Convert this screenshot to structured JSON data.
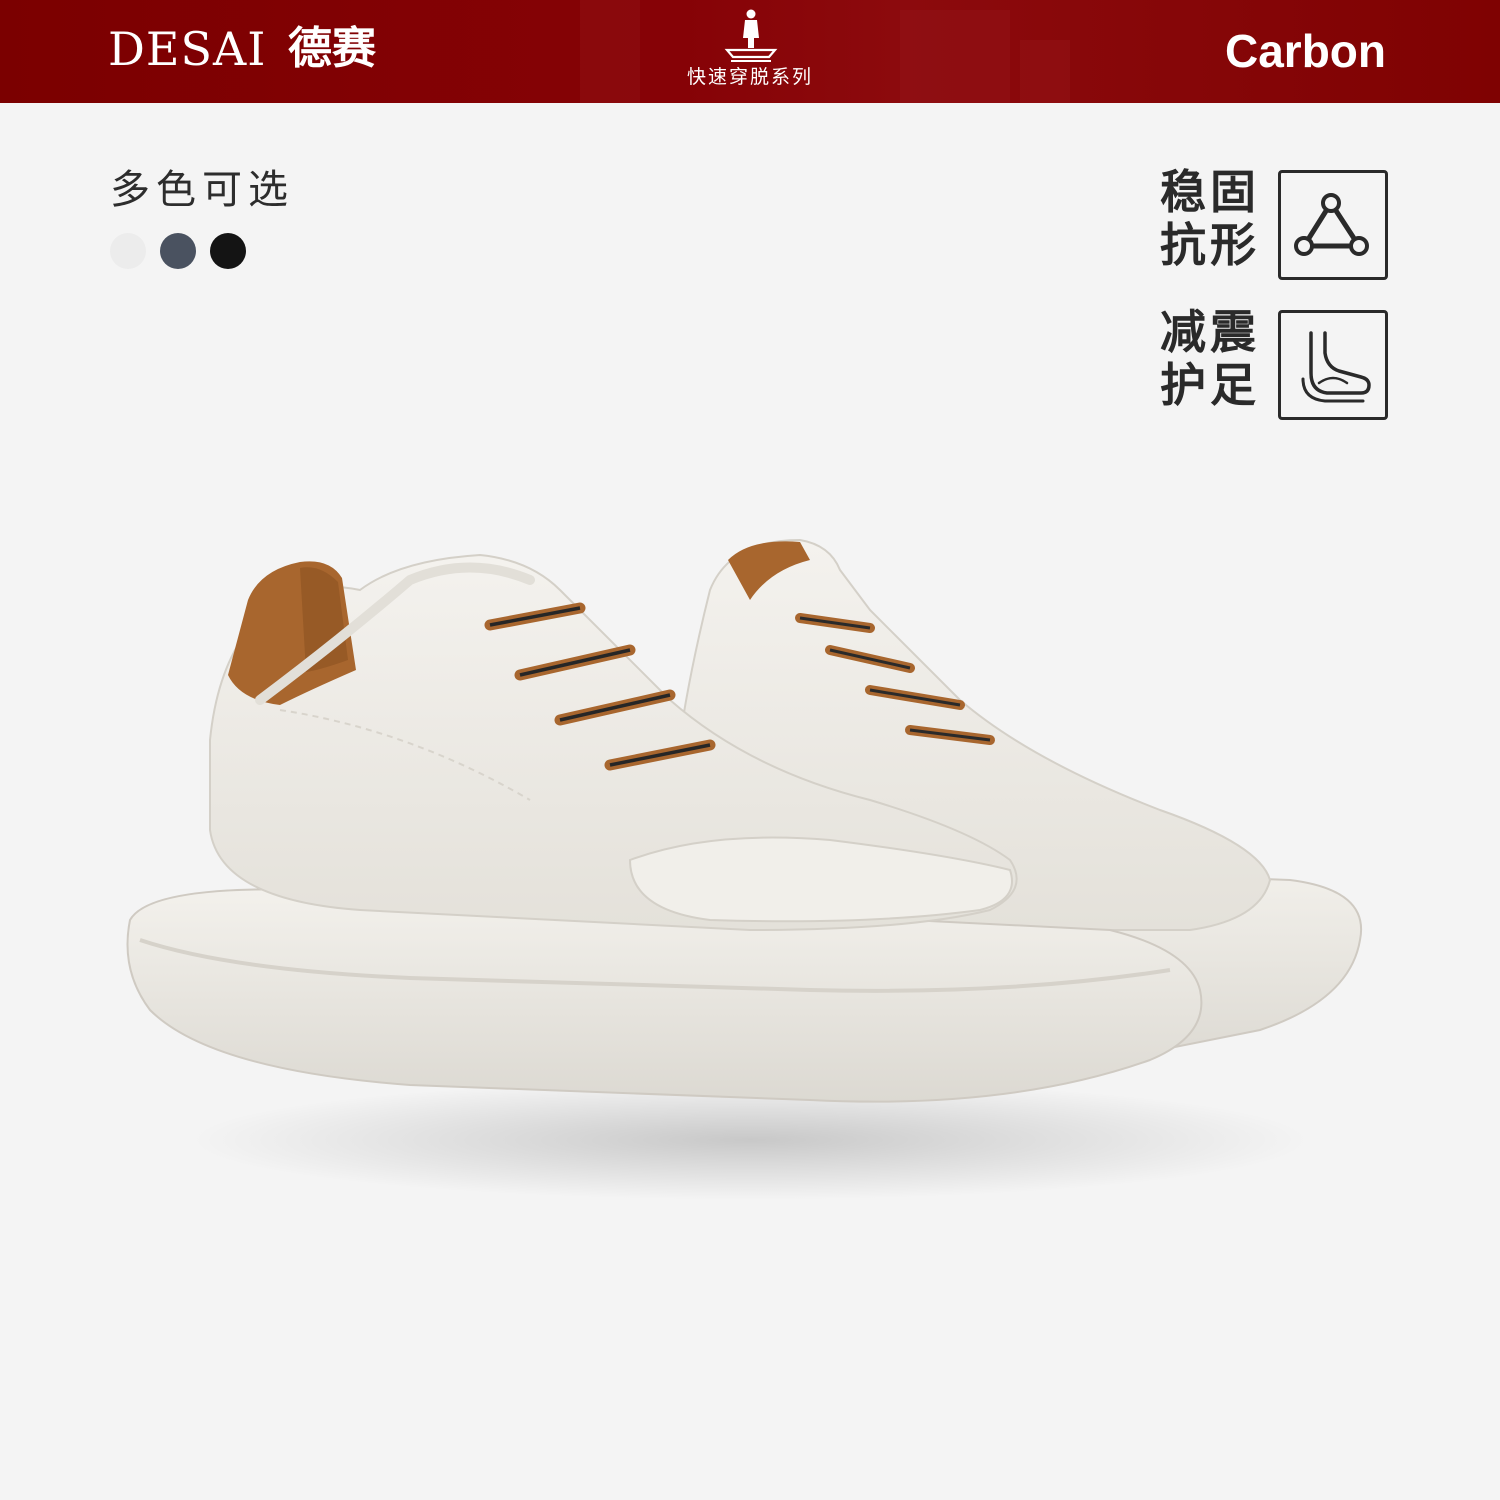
{
  "header": {
    "brand_latin": "DESAI",
    "brand_cn": "德赛",
    "series_title": "快速穿脱系列",
    "model_name": "Carbon",
    "background_color": "#7f0003"
  },
  "colors": {
    "heading": "多色可选",
    "swatches": [
      "#ececec",
      "#4a5260",
      "#141414"
    ]
  },
  "features": [
    {
      "line1": "稳固",
      "line2": "抗形",
      "icon": "triangle-nodes-icon"
    },
    {
      "line1": "减震",
      "line2": "护足",
      "icon": "foot-cushion-icon"
    }
  ],
  "product": {
    "icon": "white-slip-on-sneaker-image",
    "upper_color": "#efede8",
    "accent_color": "#a8662e"
  }
}
